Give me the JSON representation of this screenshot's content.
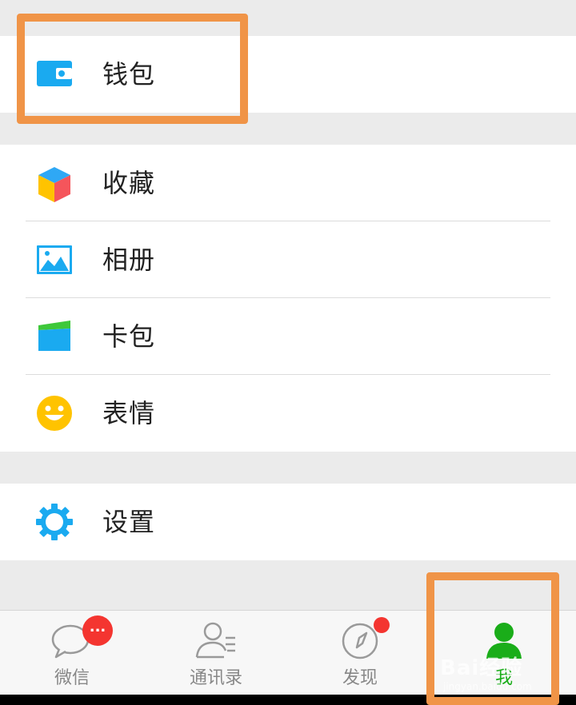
{
  "menu": {
    "wallet": {
      "label": "钱包",
      "icon": "wallet-icon"
    },
    "items": [
      {
        "label": "收藏",
        "icon": "favorites-cube-icon"
      },
      {
        "label": "相册",
        "icon": "album-picture-icon"
      },
      {
        "label": "卡包",
        "icon": "card-wallet-icon"
      },
      {
        "label": "表情",
        "icon": "smiley-face-icon"
      }
    ],
    "settings": {
      "label": "设置",
      "icon": "gear-icon"
    }
  },
  "tabbar": {
    "tabs": [
      {
        "label": "微信",
        "icon": "chat-bubble-icon",
        "badge": "..."
      },
      {
        "label": "通讯录",
        "icon": "contacts-icon"
      },
      {
        "label": "发现",
        "icon": "compass-icon",
        "dot": true
      },
      {
        "label": "我",
        "icon": "person-icon",
        "active": true
      }
    ]
  },
  "watermark": {
    "text": "Bai经验",
    "sub": "jingyan.baidu.com"
  },
  "colors": {
    "highlight": "#f09447",
    "accent_blue": "#1aaaf0",
    "active_green": "#1aad19",
    "badge_red": "#f43530"
  }
}
